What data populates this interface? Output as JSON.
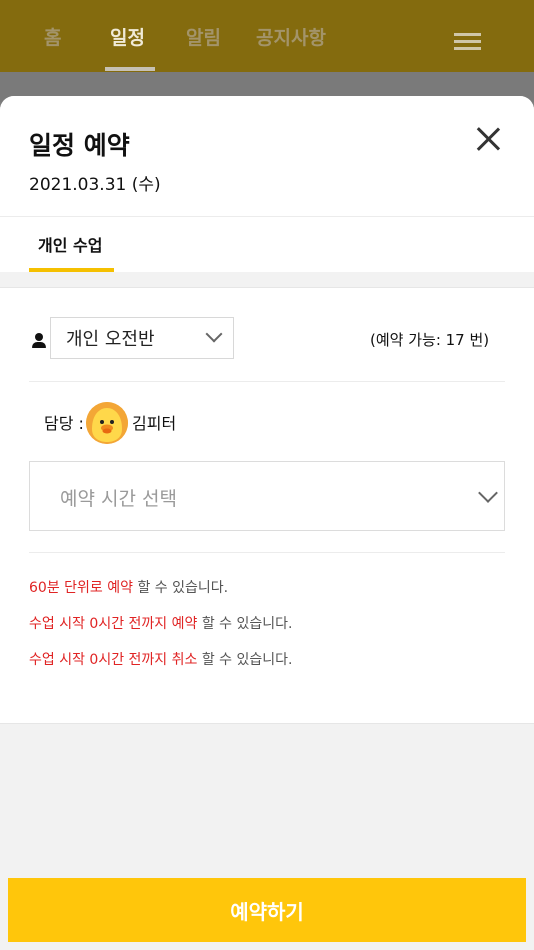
{
  "nav": {
    "tabs": [
      {
        "label": "홈"
      },
      {
        "label": "일정"
      },
      {
        "label": "알림"
      },
      {
        "label": "공지사항"
      }
    ],
    "active_tab": "일정"
  },
  "modal": {
    "title": "일정 예약",
    "date": "2021.03.31 (수)",
    "sub_tab": "개인 수업",
    "class_select": {
      "value": "개인 오전반"
    },
    "availability": "(예약 가능: 17 번)",
    "teacher": {
      "label": "담당 :",
      "name": "김피터"
    },
    "time_select": {
      "placeholder": "예약 시간 선택"
    },
    "notes": [
      {
        "highlight": "60분 단위로 예약",
        "rest": " 할 수 있습니다."
      },
      {
        "highlight": "수업 시작 0시간 전까지 예약",
        "rest": " 할 수 있습니다."
      },
      {
        "highlight": "수업 시작 0시간 전까지 취소",
        "rest": " 할 수 있습니다."
      }
    ],
    "submit_label": "예약하기"
  },
  "colors": {
    "accent": "#ffc60b",
    "highlight_text": "#e02424",
    "nav_dimmed": "#846b0e"
  },
  "icons": [
    "hamburger-menu-icon",
    "close-icon",
    "person-icon",
    "chevron-down-icon"
  ]
}
